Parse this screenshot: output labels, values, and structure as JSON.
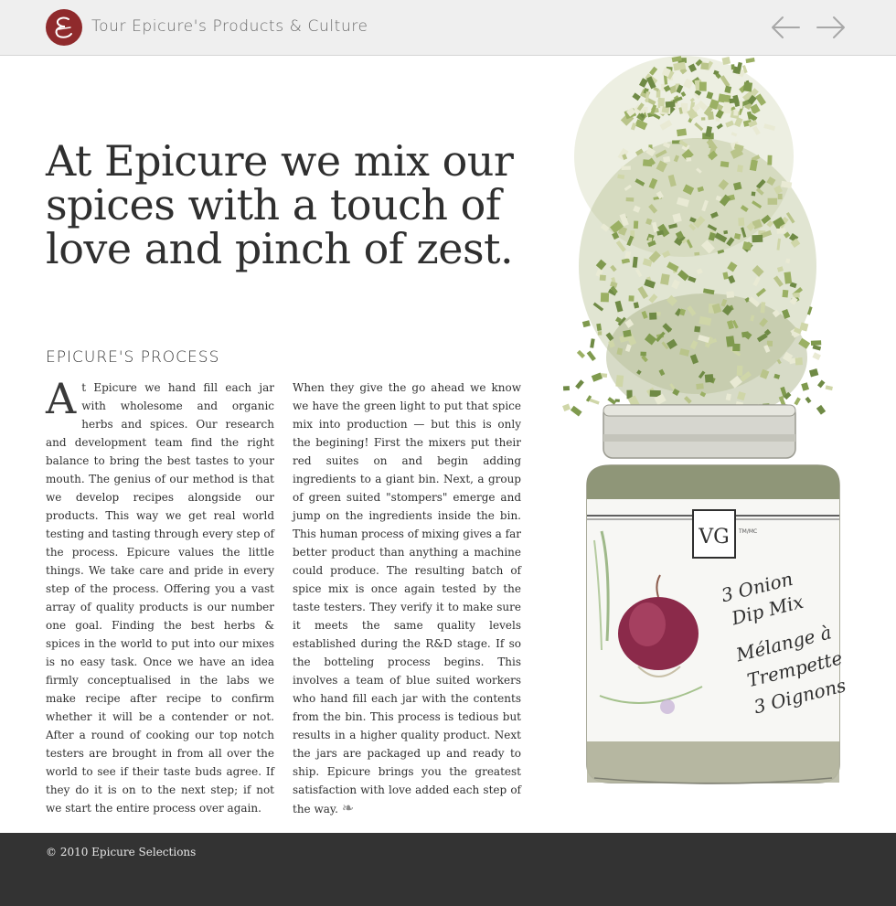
{
  "header": {
    "title": "Tour Epicure's Products & Culture",
    "logo_icon": "epicure-logo-icon",
    "prev_icon": "arrow-left-icon",
    "next_icon": "arrow-right-icon",
    "brand_color": "#8f2a2c"
  },
  "hero": {
    "headline": "At Epicure we mix our spices with a touch of love and pinch of zest."
  },
  "process": {
    "heading": "EPICURE'S PROCESS",
    "dropcap": "A",
    "col1": "t Epicure we hand fill each jar with wholesome and organic herbs and spices. Our research and development team find the right balance to bring the best tastes to your mouth. The genius of our method is that we develop recipes alongside our products. This way we get real world testing and tasting through every step of the process. Epicure values the little things. We take care and pride in every step of the process. Offering you a vast array of quality products is our number one goal. Finding the best herbs & spices in the world to put into our mixes is no easy task. Once we have an idea firmly conceptualised in the labs we make recipe after recipe to confirm whether it will be a contender or not. After a round of cooking our top notch testers are brought in from all over the world to see if their taste buds agree. If they do it is on to the next step; if not we start the entire process over again.",
    "col2": "When they give the go ahead we know we have the green light to put that spice mix into production — but this is only the begining! First the mixers put their red suites on and begin adding ingredients to a giant bin. Next, a group of green suited \"stompers\" emerge and jump on the ingredients inside the bin. This human process of mixing gives a far better product than anything a machine could produce. The resulting batch of spice mix is once again tested by the taste testers. They verify it to make sure it meets the same quality levels established during the R&D stage. If so the botteling process begins. This involves a team of blue suited workers who hand fill each jar with the contents from the bin. This process is tedious but results in a higher quality product. Next the jars are packaged up and ready to ship. Epicure brings you the greatest satisfaction with love added each step of the way.",
    "end_mark": "❧"
  },
  "product": {
    "label_monogram": "VG",
    "label_tm": "TM/MC",
    "label_line1": "3 Onion",
    "label_line2": "Dip Mix",
    "label_line3": "Mélange à",
    "label_line4": "Trempette",
    "label_line5": "3 Oignons"
  },
  "footer": {
    "copyright": "© 2010 Epicure Selections"
  }
}
